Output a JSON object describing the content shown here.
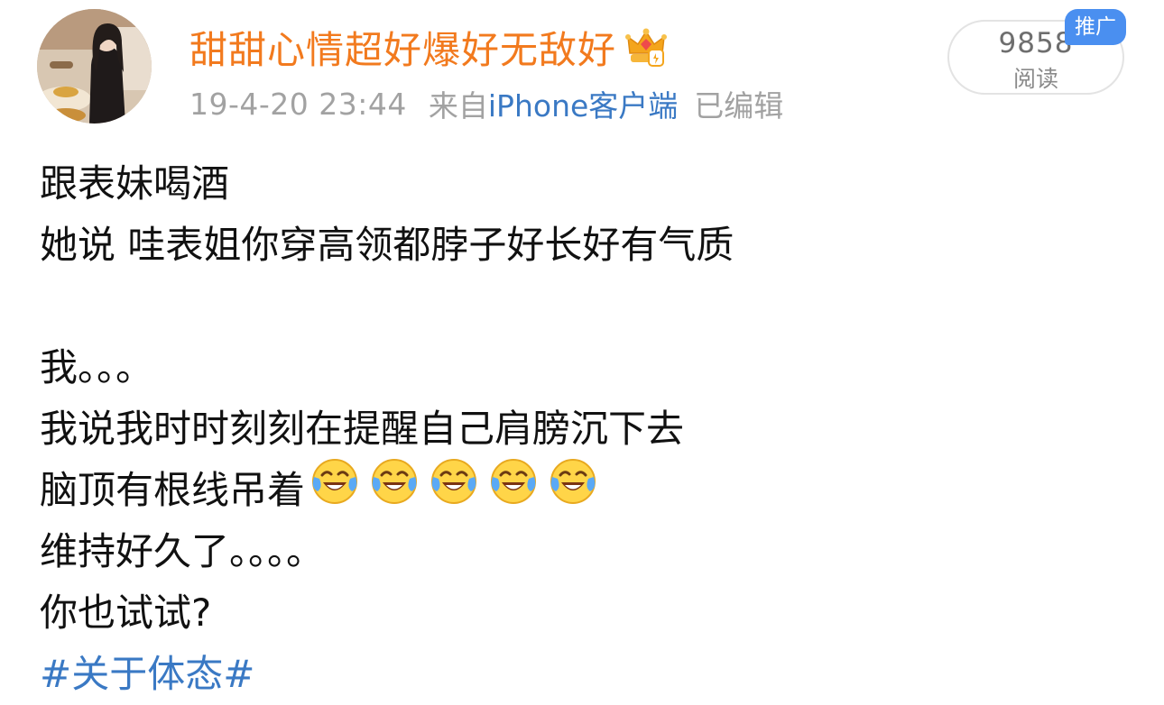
{
  "user": {
    "name": "甜甜心情超好爆好无敌好",
    "badge_icon": "crown-vip-icon"
  },
  "meta": {
    "time": "19-4-20 23:44",
    "from_label": "来自",
    "source": "iPhone客户端",
    "edited": "已编辑"
  },
  "stats": {
    "read_count": "9858",
    "read_label": "阅读",
    "promo_badge": "推广"
  },
  "post": {
    "lines": [
      "跟表妹喝酒",
      "她说 哇表姐你穿高领都脖子好长好有气质",
      "",
      "我。。。",
      "我说我时时刻刻在提醒自己肩膀沉下去",
      "脑顶有根线吊着",
      "维持好久了。。。。",
      "你也试试?"
    ],
    "emoji_icon": "laugh-cry-emoji-icon",
    "emoji_count": 5,
    "hashtag": "#关于体态#"
  },
  "colors": {
    "username": "#f27a1e",
    "link": "#3a79c4",
    "meta": "#a2a2a2",
    "badge": "#4a8ff0"
  }
}
